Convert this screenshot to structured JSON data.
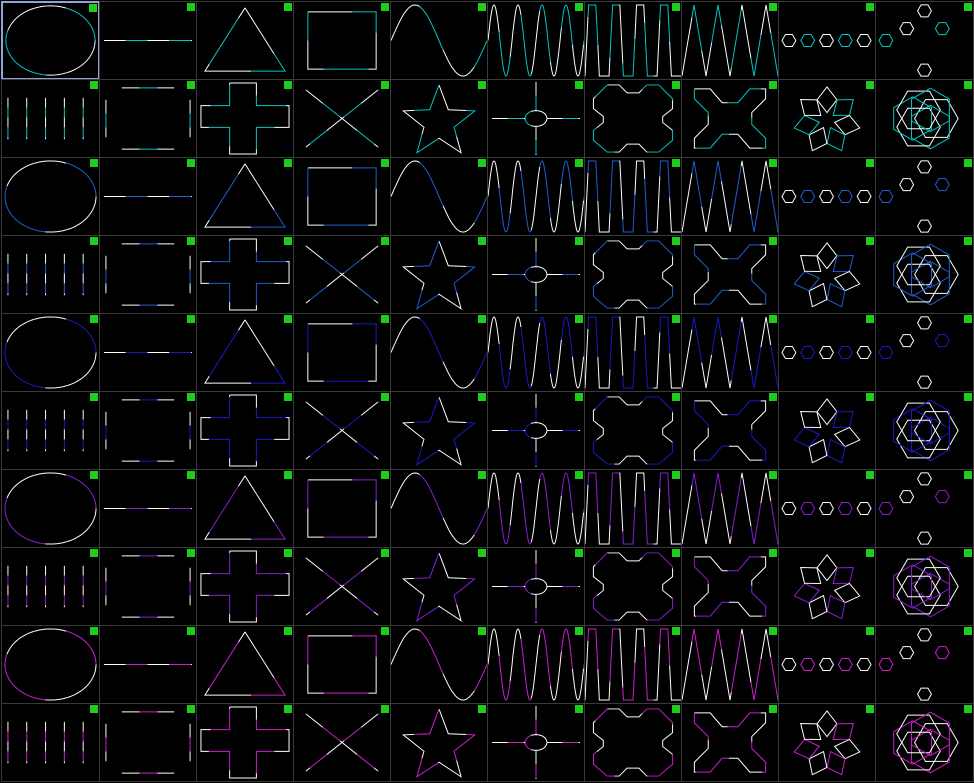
{
  "app": {
    "background": "#000000",
    "grid_line_color": "#3a3a3a",
    "marker_color": "#1ecc1e",
    "selected_border_color": "#8fa3d6",
    "white": "#ffffff"
  },
  "rows": [
    {
      "row_type": "A",
      "accent": "#00c8c8"
    },
    {
      "row_type": "B",
      "accent": "#00c8c8"
    },
    {
      "row_type": "A",
      "accent": "#1e5fd0"
    },
    {
      "row_type": "B",
      "accent": "#1e5fd0"
    },
    {
      "row_type": "A",
      "accent": "#1a1ac8"
    },
    {
      "row_type": "B",
      "accent": "#1a1ac8"
    },
    {
      "row_type": "A",
      "accent": "#8a1ed0"
    },
    {
      "row_type": "B",
      "accent": "#8a1ed0"
    },
    {
      "row_type": "A",
      "accent": "#d01ed0"
    },
    {
      "row_type": "B",
      "accent": "#d01ed0"
    }
  ],
  "shapes_row_a": [
    "ellipse-icon",
    "line-icon",
    "triangle-icon",
    "square-icon",
    "sine-wave-icon",
    "dense-sine-icon",
    "trapezoid-wave-icon",
    "zigzag-icon",
    "hexagon-row-icon",
    "hexagon-cross-icon"
  ],
  "shapes_row_b": [
    "vertical-lines-icon",
    "bracket-frame-icon",
    "plus-cross-icon",
    "x-cross-icon",
    "star-icon",
    "crosshair-icon",
    "rounded-x-icon",
    "x-polygon-icon",
    "diamond-flower-icon",
    "rosette-icon"
  ],
  "selected_cell": {
    "row": 0,
    "col": 0
  }
}
